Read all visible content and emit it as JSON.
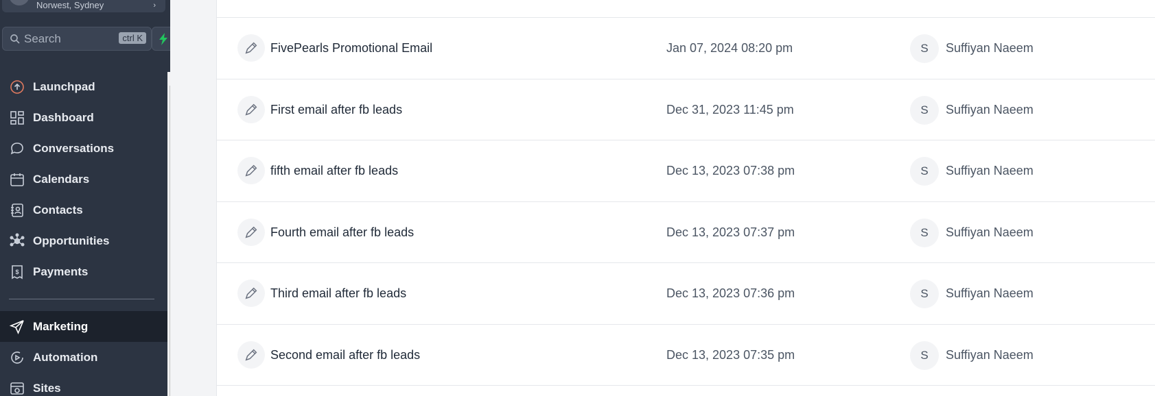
{
  "location": {
    "name": "Norwest, Sydney"
  },
  "search": {
    "placeholder": "Search",
    "shortcut": "ctrl K"
  },
  "sidebar": {
    "items": [
      {
        "label": "Launchpad",
        "icon": "launchpad-icon",
        "active": false
      },
      {
        "label": "Dashboard",
        "icon": "dashboard-icon",
        "active": false
      },
      {
        "label": "Conversations",
        "icon": "conversations-icon",
        "active": false
      },
      {
        "label": "Calendars",
        "icon": "calendar-icon",
        "active": false
      },
      {
        "label": "Contacts",
        "icon": "contacts-icon",
        "active": false
      },
      {
        "label": "Opportunities",
        "icon": "opportunities-icon",
        "active": false
      },
      {
        "label": "Payments",
        "icon": "payments-icon",
        "active": false
      }
    ],
    "items2": [
      {
        "label": "Marketing",
        "icon": "marketing-icon",
        "active": true
      },
      {
        "label": "Automation",
        "icon": "automation-icon",
        "active": false
      },
      {
        "label": "Sites",
        "icon": "sites-icon",
        "active": false
      }
    ]
  },
  "templates": {
    "rows": [
      {
        "name": "FivePearls Promotional Email",
        "date": "Jan 07, 2024 08:20 pm",
        "avatar": "S",
        "user": "Suffiyan Naeem"
      },
      {
        "name": "First email after fb leads",
        "date": "Dec 31, 2023 11:45 pm",
        "avatar": "S",
        "user": "Suffiyan Naeem"
      },
      {
        "name": "fifth email after fb leads",
        "date": "Dec 13, 2023 07:38 pm",
        "avatar": "S",
        "user": "Suffiyan Naeem"
      },
      {
        "name": "Fourth email after fb leads",
        "date": "Dec 13, 2023 07:37 pm",
        "avatar": "S",
        "user": "Suffiyan Naeem"
      },
      {
        "name": "Third email after fb leads",
        "date": "Dec 13, 2023 07:36 pm",
        "avatar": "S",
        "user": "Suffiyan Naeem"
      },
      {
        "name": "Second email after fb leads",
        "date": "Dec 13, 2023 07:35 pm",
        "avatar": "S",
        "user": "Suffiyan Naeem"
      }
    ]
  },
  "colors": {
    "sidebar_bg": "#2c3442",
    "active_bg": "#1c222c",
    "bolt": "#22c55e"
  }
}
